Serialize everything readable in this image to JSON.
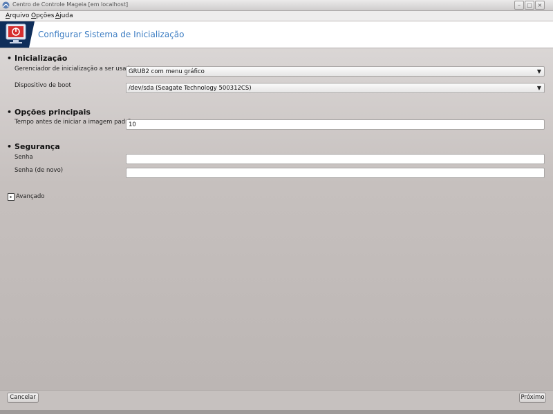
{
  "window": {
    "title": "Centro de Controle Mageia  [em localhost]",
    "controls": {
      "minimize": "–",
      "maximize": "□",
      "close": "×"
    }
  },
  "menu": [
    {
      "label": "Arquivo"
    },
    {
      "label": "Opções"
    },
    {
      "label": "Ajuda"
    }
  ],
  "banner": {
    "title": "Configurar Sistema de Inicialização",
    "icon": "boot-power-monitor-icon"
  },
  "sections": {
    "boot": {
      "title": "Inicialização",
      "bootloader_label": "Gerenciador de inicialização a ser usado",
      "bootloader_value": "GRUB2 com menu gráfico",
      "device_label": "Dispositivo de boot",
      "device_value": "/dev/sda (Seagate Technology 500312CS)"
    },
    "main": {
      "title": "Opções principais",
      "timeout_label": "Tempo antes de iniciar a imagem padrão",
      "timeout_value": "10"
    },
    "security": {
      "title": "Segurança",
      "password_label": "Senha",
      "password_value": "",
      "password_again_label": "Senha (de novo)",
      "password_again_value": ""
    }
  },
  "advanced": {
    "label": "Avançado",
    "arrow": "▸"
  },
  "footer": {
    "cancel_label": "Cancelar",
    "next_label": "Próximo"
  },
  "glyphs": {
    "bullet": "•",
    "dropdown": "▼"
  },
  "colors": {
    "banner_title": "#3b7cc2",
    "icon_red": "#d62f2f"
  }
}
